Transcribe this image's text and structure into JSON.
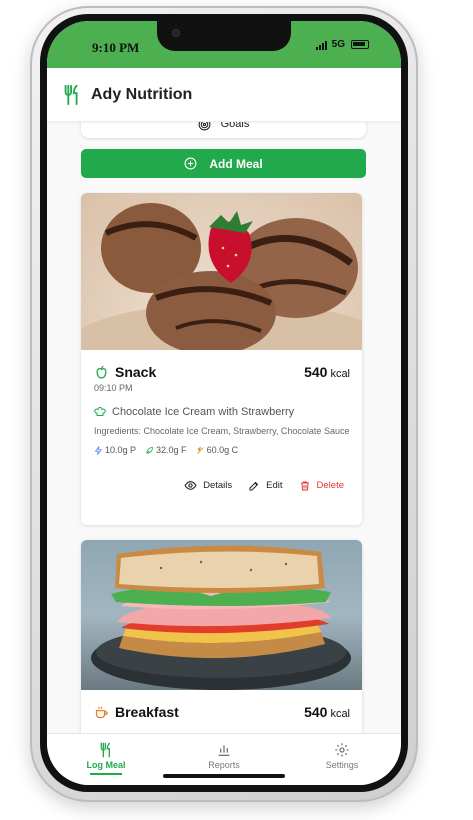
{
  "status_bar": {
    "time": "9:10 PM",
    "network": "5G"
  },
  "header": {
    "title": "Ady Nutrition",
    "logo_icon": "fork-knife-icon"
  },
  "goals": {
    "label": "Goals",
    "icon": "target-icon"
  },
  "add_meal": {
    "label": "Add Meal",
    "icon": "plus-circle-icon"
  },
  "meals": [
    {
      "type": "Snack",
      "type_icon": "apple-icon",
      "time": "09:10 PM",
      "calories": "540",
      "calories_unit": "kcal",
      "name": "Chocolate Ice Cream with Strawberry",
      "ingredients": "Ingredients: Chocolate Ice Cream, Strawberry, Chocolate Sauce",
      "protein": "10.0g P",
      "fat": "32.0g F",
      "carbs": "60.0g C"
    },
    {
      "type": "Breakfast",
      "type_icon": "coffee-icon",
      "calories": "540",
      "calories_unit": "kcal"
    }
  ],
  "actions": {
    "details": "Details",
    "edit": "Edit",
    "delete": "Delete"
  },
  "nav": {
    "items": [
      {
        "label": "Log Meal",
        "icon": "fork-knife-icon"
      },
      {
        "label": "Reports",
        "icon": "bar-chart-icon"
      },
      {
        "label": "Settings",
        "icon": "gear-icon"
      }
    ],
    "active": "Log Meal"
  },
  "colors": {
    "brand_green": "#22a94b",
    "status_green": "#4caf50",
    "delete_red": "#e53935"
  }
}
